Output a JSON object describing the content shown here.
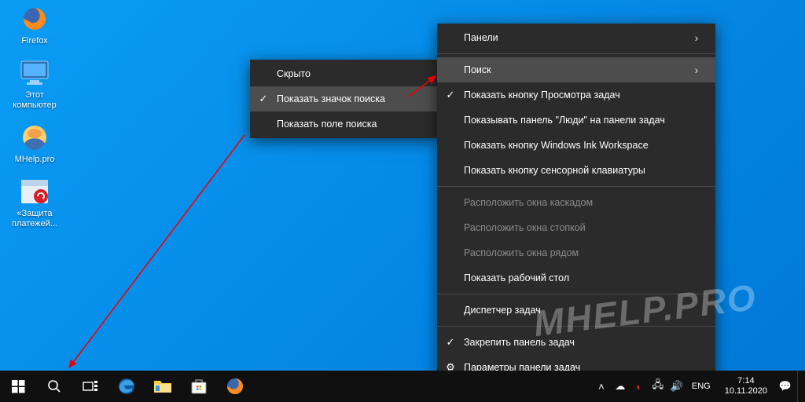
{
  "desktop_icons": [
    {
      "name": "firefox-icon",
      "label": "Firefox"
    },
    {
      "name": "this-pc-icon",
      "label": "Этот\nкомпьютер"
    },
    {
      "name": "mhelp-icon",
      "label": "MHelp.pro"
    },
    {
      "name": "trend-icon",
      "label": "«Защита\nплатежей..."
    }
  ],
  "submenu": {
    "items": [
      {
        "label": "Скрыто",
        "checked": false,
        "hover": false
      },
      {
        "label": "Показать значок поиска",
        "checked": true,
        "hover": true
      },
      {
        "label": "Показать поле поиска",
        "checked": false,
        "hover": false
      }
    ]
  },
  "mainmenu": {
    "groups": [
      [
        {
          "label": "Панели",
          "arrow": true
        },
        {
          "label": "Поиск",
          "arrow": true,
          "hover": true
        },
        {
          "label": "Показать кнопку Просмотра задач",
          "checked": true
        },
        {
          "label": "Показывать панель \"Люди\" на панели задач"
        },
        {
          "label": "Показать кнопку Windows Ink Workspace"
        },
        {
          "label": "Показать кнопку сенсорной клавиатуры"
        }
      ],
      [
        {
          "label": "Расположить окна каскадом",
          "disabled": true
        },
        {
          "label": "Расположить окна стопкой",
          "disabled": true
        },
        {
          "label": "Расположить окна рядом",
          "disabled": true
        },
        {
          "label": "Показать рабочий стол"
        }
      ],
      [
        {
          "label": "Диспетчер задач"
        }
      ],
      [
        {
          "label": "Закрепить панель задач",
          "checked": true
        },
        {
          "label": "Параметры панели задач",
          "icon": "gear"
        }
      ]
    ]
  },
  "watermark": "MHELP.PRO",
  "tray": {
    "lang": "ENG",
    "time": "7:14",
    "date": "10.11.2020"
  }
}
